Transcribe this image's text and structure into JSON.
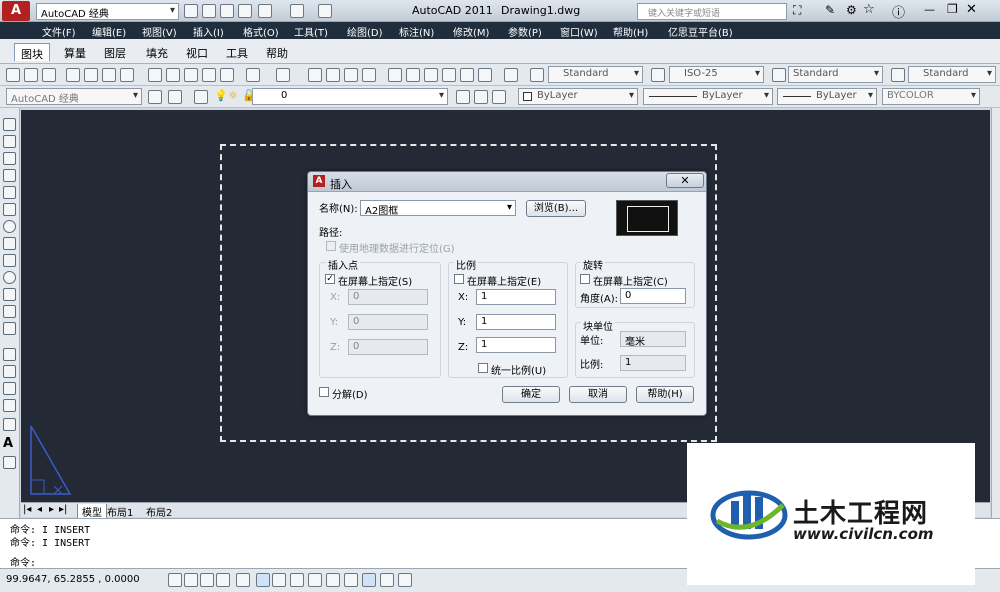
{
  "titlebar": {
    "workspace": "AutoCAD 经典",
    "app_title": "AutoCAD 2011",
    "doc_title": "Drawing1.dwg",
    "search_placeholder": "键入关键字或短语"
  },
  "menu": [
    "文件(F)",
    "编辑(E)",
    "视图(V)",
    "插入(I)",
    "格式(O)",
    "工具(T)",
    "绘图(D)",
    "标注(N)",
    "修改(M)",
    "参数(P)",
    "窗口(W)",
    "帮助(H)",
    "亿思豆平台(B)"
  ],
  "ribbon_tabs": [
    "图块",
    "算量",
    "图层",
    "填充",
    "视口",
    "工具",
    "帮助"
  ],
  "toolbar1": {
    "text_style": "Standard",
    "dim_style": "ISO-25",
    "table_style": "Standard",
    "multileader_style": "Standard"
  },
  "toolbar2": {
    "workspace": "AutoCAD 经典",
    "layer": "0",
    "color": "ByLayer",
    "linetype": "ByLayer",
    "lineweight": "ByLayer",
    "plotstyle": "BYCOLOR"
  },
  "layout_tabs": [
    "模型",
    "布局1",
    "布局2"
  ],
  "command_lines": [
    "命令: I INSERT",
    "命令: I INSERT",
    "命令:"
  ],
  "status": {
    "coords": "99.9647,  65.2855 , 0.0000"
  },
  "dialog": {
    "title": "插入",
    "name_label": "名称(N):",
    "name_value": "A2图框",
    "browse": "浏览(B)...",
    "path_label": "路径:",
    "geo_label": "使用地理数据进行定位(G)",
    "insertion": {
      "title": "插入点",
      "onscreen": "在屏幕上指定(S)",
      "x_label": "X:",
      "y_label": "Y:",
      "z_label": "Z:",
      "x": "0",
      "y": "0",
      "z": "0"
    },
    "scale": {
      "title": "比例",
      "onscreen": "在屏幕上指定(E)",
      "x_label": "X:",
      "y_label": "Y:",
      "z_label": "Z:",
      "x": "1",
      "y": "1",
      "z": "1",
      "uniform": "统一比例(U)"
    },
    "rotation": {
      "title": "旋转",
      "onscreen": "在屏幕上指定(C)",
      "angle_label": "角度(A):",
      "angle": "0"
    },
    "block_unit": {
      "title": "块单位",
      "unit_label": "单位:",
      "unit": "毫米",
      "factor_label": "比例:",
      "factor": "1"
    },
    "explode": "分解(D)",
    "ok": "确定",
    "cancel": "取消",
    "help": "帮助(H)"
  },
  "watermark": {
    "cn": "土木工程网",
    "url": "www.civilcn.com"
  },
  "colors": {
    "canvas": "#232a35",
    "menubar": "#1f2d3c",
    "logo_blue": "#1f5fae",
    "logo_green": "#6fb52c"
  }
}
